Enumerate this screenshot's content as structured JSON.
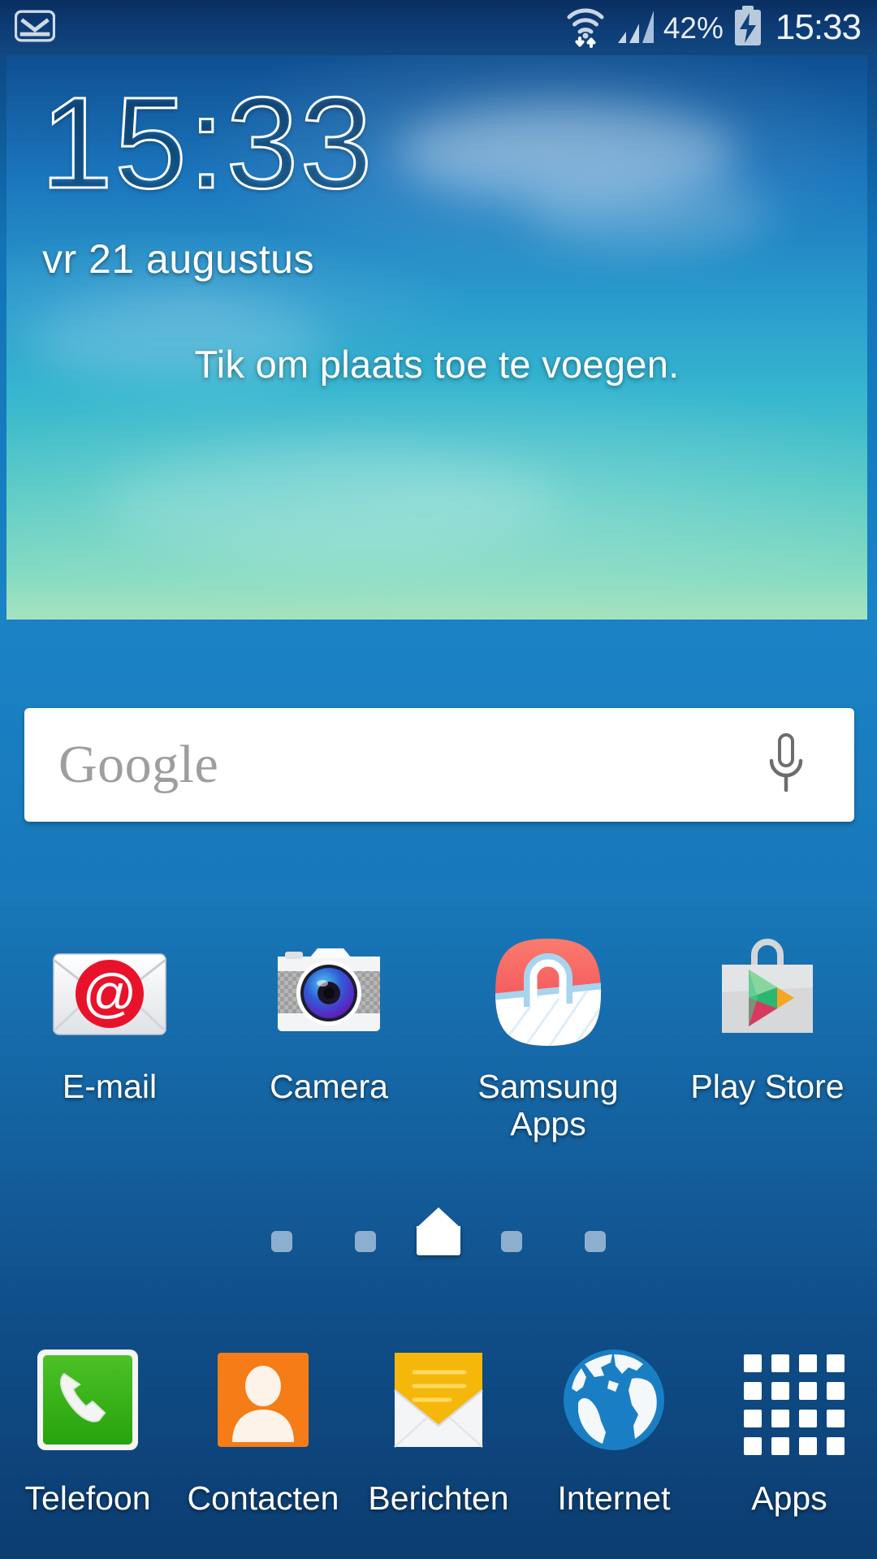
{
  "status_bar": {
    "notification_icon": "gmail-icon",
    "wifi_icon": "wifi-signal-icon",
    "cellular_icon": "cellular-signal-icon",
    "battery_percent": "42%",
    "battery_icon": "battery-charging-icon",
    "clock": "15:33"
  },
  "weather_widget": {
    "time": "15:33",
    "date": "vr 21 augustus",
    "hint": "Tik om plaats toe te voegen."
  },
  "search": {
    "logo_text": "Google",
    "placeholder": "Google",
    "voice_icon": "microphone-icon"
  },
  "app_grid": [
    {
      "label": "E-mail",
      "icon": "email-envelope-icon"
    },
    {
      "label": "Camera",
      "icon": "camera-icon"
    },
    {
      "label": "Samsung\nApps",
      "label_line1": "Samsung",
      "label_line2": "Apps",
      "icon": "samsung-apps-basket-icon"
    },
    {
      "label": "Play Store",
      "icon": "play-store-bag-icon"
    }
  ],
  "page_indicators": {
    "count": 5,
    "current_index": 2,
    "home_icon": "home-house-icon"
  },
  "dock": [
    {
      "label": "Telefoon",
      "icon": "phone-handset-icon"
    },
    {
      "label": "Contacten",
      "icon": "contacts-person-icon"
    },
    {
      "label": "Berichten",
      "icon": "messages-envelope-icon"
    },
    {
      "label": "Internet",
      "icon": "internet-globe-icon"
    },
    {
      "label": "Apps",
      "icon": "apps-grid-icon"
    }
  ],
  "colors": {
    "wallpaper_top": "#1273b6",
    "wallpaper_bottom": "#0c3d71",
    "status_bar": "#0e3e79",
    "search_bar": "#ffffff",
    "phone_green": "#3aaa22",
    "contacts_orange": "#f57c17",
    "messages_yellow": "#f5b70a",
    "internet_blue": "#1a7ec4",
    "email_red": "#e8132a"
  }
}
